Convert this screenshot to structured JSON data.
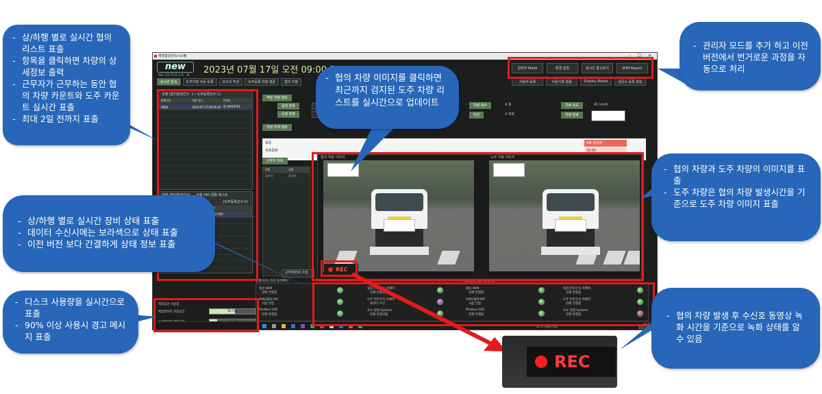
{
  "slide_title": "",
  "app": {
    "window_title": "계측함공단속시스템",
    "logo": "new",
    "version": "Ver 23.714.1.0 - B",
    "datetime": "2023년 07월 17일 오전 09:00:36",
    "top_buttons": [
      "관리자 Mode",
      "환경 설정",
      "실시간 통신보기",
      "WIM Report"
    ],
    "sub_buttons": [
      "사용자 등록",
      "사용기록 열람",
      "Display Board",
      "검문소 등록 정보"
    ],
    "nav_tabs": [
      "실시간 단속",
      "도주차량 수동 등록",
      "보고서 작성",
      "도주등록 차량 열람",
      "협의 차량"
    ],
    "left_list": {
      "title": "상행 (협의발생건수: 1 / 도주등록건수:1)",
      "headers": [
        "발행번호",
        "적발 일시",
        "번호판"
      ],
      "rows": [
        [
          "4684",
          "2023-07-17 09:26:42",
          "경구4918701"
        ]
      ]
    },
    "left_list2": {
      "tabs": [
        "하행 (협의발생건수)",
        "상행 DIO 알람 테스트"
      ],
      "title": "(도주등록건수:0)",
      "headers": [
        "발행번호",
        "번호판"
      ],
      "rows": [
        [
          "400302",
          "98구사1704"
        ]
      ]
    },
    "detail": {
      "section_vehicle": "적발 차량 정보",
      "vehicle_number_label": "입력 번호",
      "direction_label": "운행 방향",
      "axle_label": "차량 축수",
      "axle_value": "4 축",
      "lane_label": "차선",
      "lane_value": "2 차로",
      "speed_label": "차량 속도",
      "speed_value": "41 km/h",
      "plate_label": "차량 번호",
      "weight_section": "차량 무게 정보",
      "weight_row1": "축중",
      "weight_row2": "측정중량",
      "total_weight_label": "4축 총중량",
      "total_weight_value": "33.80",
      "staff_section": "근무자 정보",
      "staff_headers": [
        "직원",
        "성명"
      ],
      "staff_row": [
        "검사자",
        "검사자"
      ],
      "collect_button": "근무자현로 수집"
    },
    "images": {
      "left_caption": "협의 차량 이미지",
      "right_caption": "도주 차량 이미지",
      "prev_arrow": "⇦",
      "next_arrow": "⇨"
    },
    "rec_label": "REC",
    "device_status": {
      "title_left": "상행(검의) 장비 동작확인",
      "title_right": "하행(검의) 장비 동작확인",
      "items": [
        {
          "label": "협의 WIM",
          "sub": "현재 연결됨",
          "color": "green"
        },
        {
          "label": "VMS/협의서버",
          "sub": "사용 안함",
          "color": "green"
        },
        {
          "label": "Modbus DIO",
          "sub": "현재 연결됨",
          "color": "green"
        },
        {
          "label": "협의 번호인식 카메라",
          "sub": "현재 연결됨",
          "color": "green"
        },
        {
          "label": "도주 번호인식 카메라",
          "sub": "데이터 수신",
          "color": "purple"
        },
        {
          "label": "초소 알림 System",
          "sub": "현재 연결안됨",
          "color": "green"
        },
        {
          "label": "협의 WIM",
          "sub": "현재 연결됨",
          "color": "green"
        },
        {
          "label": "VMS/협의서버",
          "sub": "사용 안함",
          "color": "green"
        },
        {
          "label": "Modbus DIO",
          "sub": "현재 연결됨",
          "color": "green"
        },
        {
          "label": "협의 번호인식 카메라",
          "sub": "현재 연결됨",
          "color": "green"
        },
        {
          "label": "도주 번호인식 카메라",
          "sub": "현재 연결됨",
          "color": "green"
        },
        {
          "label": "초소 알림 System",
          "sub": "현재 연결됨",
          "color": "red"
        }
      ]
    },
    "disk": {
      "title": "저장공간 사용량",
      "backup_label": "백업데이터 저장공간",
      "backup_pct": "56.5%",
      "backup_value": 0.565,
      "store_label": "수신데이터 저장공간",
      "store_pct": "16.7%",
      "store_value": 0.167
    },
    "taskbar": {
      "weather": "26°C 대체로 흐림",
      "time": "오전 9:00",
      "date": "2023-07-17"
    }
  },
  "callouts": {
    "top_left": [
      "상/하행 별로 실시간 협의 리스트 표출",
      "항목을 클릭하면 차량의 상세정보 출력",
      "근무자가 근무하는 동안 협의 차량 카운트와 도주 카운트 실시간 표출",
      "최대 2일 전까지 표출"
    ],
    "top_center": [
      "협의 차량 이미지를 클릭하면 최근까지 검지된 도주 차량 리스트를 실시간으로 업데이트"
    ],
    "top_right": [
      "관리자 모드를 추가 하고 이전 버전에서 번거로운 과정을 자동으로 처리"
    ],
    "mid_right": [
      "협의 차량과 도주 차량의 이미지를 표출",
      "도주 차량은 협의 차량 발생시간을 기준으로 도주 차량 이미지 표출"
    ],
    "mid_left": [
      "상/하행 별로 실시간 장비 상태 표출",
      "데이터 수신시에는 보라색으로 상태 표출",
      "이전 버전 보다 간결하게 상태 정보 표출"
    ],
    "bottom_left": [
      "디스크 사용량을 실시간으로 표출",
      "90% 이상 사용시 경고 메시지 표출"
    ],
    "bottom_right": [
      "협의 차량 발생 후 수신호 동영상 녹화 시간을 기준으로 녹화 상태를  알 수 있음"
    ]
  },
  "zoom_rec_label": "REC",
  "colors": {
    "callout_blue": "#2766b8",
    "annotation_red": "#e21b1b",
    "accent_green": "#5c7a56"
  }
}
